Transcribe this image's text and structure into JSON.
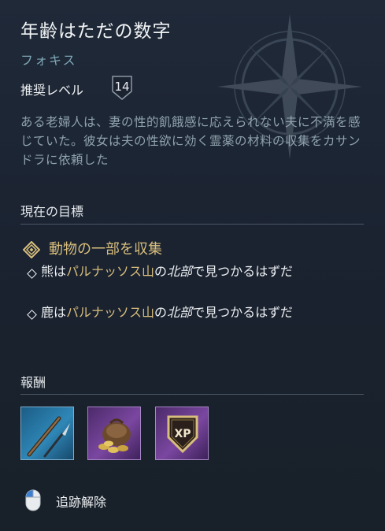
{
  "quest": {
    "title": "年齢はただの数字",
    "region": "フォキス",
    "level_label": "推奨レベル",
    "level": "14",
    "description": "ある老婦人は、妻の性的飢餓感に応えられない夫に不満を感じていた。彼女は夫の性欲に効く霊薬の材料の収集をカサンドラに依頼した"
  },
  "objectives": {
    "header": "現在の目標",
    "main": "動物の一部を収集",
    "items": [
      {
        "animal": "熊は",
        "place": "パルナッソス山",
        "particle": "の",
        "direction": "北部",
        "rest": "で見つかるはずだ"
      },
      {
        "animal": "鹿は",
        "place": "パルナッソス山",
        "particle": "の",
        "direction": "北部",
        "rest": "で見つかるはずだ"
      }
    ]
  },
  "rewards": {
    "header": "報酬",
    "items": [
      {
        "icon": "spear-icon",
        "rarity_color": "#2f87b7"
      },
      {
        "icon": "drachmae-pouch-icon",
        "rarity_color": "#7a47a0"
      },
      {
        "icon": "xp-badge-icon",
        "rarity_color": "#7a47a0",
        "label": "XP"
      }
    ]
  },
  "action": {
    "icon": "mouse-left-click-icon",
    "label": "追跡解除"
  },
  "colors": {
    "accent_gold": "#d8be7c",
    "region_blue": "#7fa8b8",
    "description_gray": "#8fa2ad"
  }
}
